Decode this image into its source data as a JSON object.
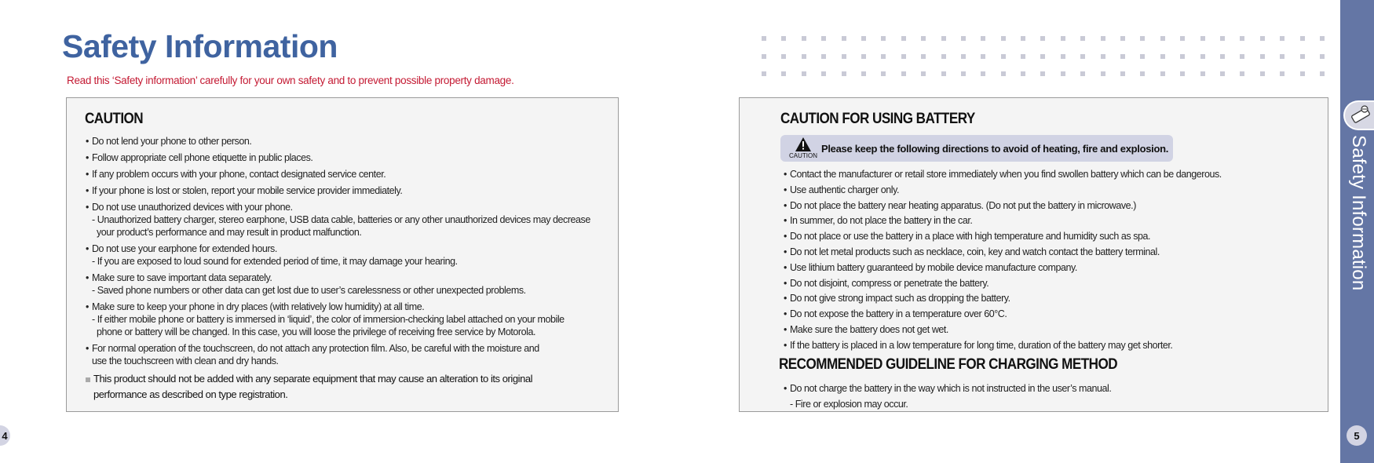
{
  "page_title": "Safety Information",
  "subtitle": "Read this ‘Safety information’ carefully for your own safety and to prevent possible property damage.",
  "left": {
    "heading": "CAUTION",
    "items": [
      {
        "text": "Do not lend your phone to other person.",
        "sub": []
      },
      {
        "text": "Follow appropriate cell phone etiquette in public places.",
        "sub": []
      },
      {
        "text": "If any problem occurs with your phone, contact designated service center.",
        "sub": []
      },
      {
        "text": "If your phone is lost or stolen, report your mobile service provider immediately.",
        "sub": []
      },
      {
        "text": "Do not use unauthorized devices with your phone.",
        "sub": [
          "- Unauthorized battery charger, stereo earphone, USB data cable, batteries or any other unauthorized devices may decrease",
          "your product’s performance and may result in product malfunction."
        ]
      },
      {
        "text": "Do not use your earphone for extended hours.",
        "sub": [
          "- If you are exposed to loud sound for extended period of time, it may damage your hearing."
        ]
      },
      {
        "text": "Make sure to save important data separately.",
        "sub": [
          "- Saved phone numbers or other data can get lost due to user’s carelessness or other unexpected problems."
        ]
      },
      {
        "text": "Make sure to keep your phone in dry places (with relatively low humidity) at all time.",
        "sub": [
          "- If either mobile phone or battery is immersed in ‘liquid’, the color of immersion-checking label attached on your mobile",
          "phone or battery will be changed.  In this case, you will loose the privilege of receiving free service by Motorola."
        ]
      },
      {
        "text": "For normal operation of the touchscreen, do not attach any protection film. Also, be careful with the moisture and",
        "sub": [
          "use the touchscreen with clean and dry hands."
        ]
      }
    ],
    "note_lines": [
      "This product should not be added with any separate equipment that may cause an alteration to its original",
      "performance as described on type registration."
    ]
  },
  "right": {
    "heading1": "CAUTION FOR USING BATTERY",
    "banner": "Please keep the following directions to avoid of heating, fire and explosion.",
    "banner_icon_label": "CAUTION",
    "items": [
      "Contact the manufacturer or retail store immediately when you find swollen battery which can be dangerous.",
      "Use authentic charger only.",
      "Do not place the battery near heating apparatus. (Do not put the battery in microwave.)",
      "In summer, do not place the battery in the car.",
      "Do not place or use the battery in a place with high temperature and humidity such as spa.",
      "Do not let metal products such as necklace, coin, key and watch contact the battery terminal.",
      "Use lithium battery guaranteed by mobile device manufacture company.",
      "Do not disjoint, compress or penetrate the battery.",
      "Do not give strong impact such as dropping the battery.",
      "Do not expose the battery in a temperature over 60°C.",
      "Make sure the battery does not get wet.",
      "If the battery is placed in a low temperature for long time, duration of the battery may get shorter."
    ],
    "heading2": "RECOMMENDED GUIDELINE FOR CHARGING METHOD",
    "items2": [
      "Do not charge the battery in the way which is not instructed in the user’s manual."
    ],
    "items2_sub": "- Fire or explosion may occur."
  },
  "sidebar": {
    "label": "Safety Information",
    "icon": "phone-icon"
  },
  "page_numbers": {
    "left": "4",
    "right": "5"
  },
  "colors": {
    "title": "#3f63a0",
    "subtitle": "#c41a33",
    "sidebar": "#6476a5",
    "banner": "#d1d3e4"
  }
}
